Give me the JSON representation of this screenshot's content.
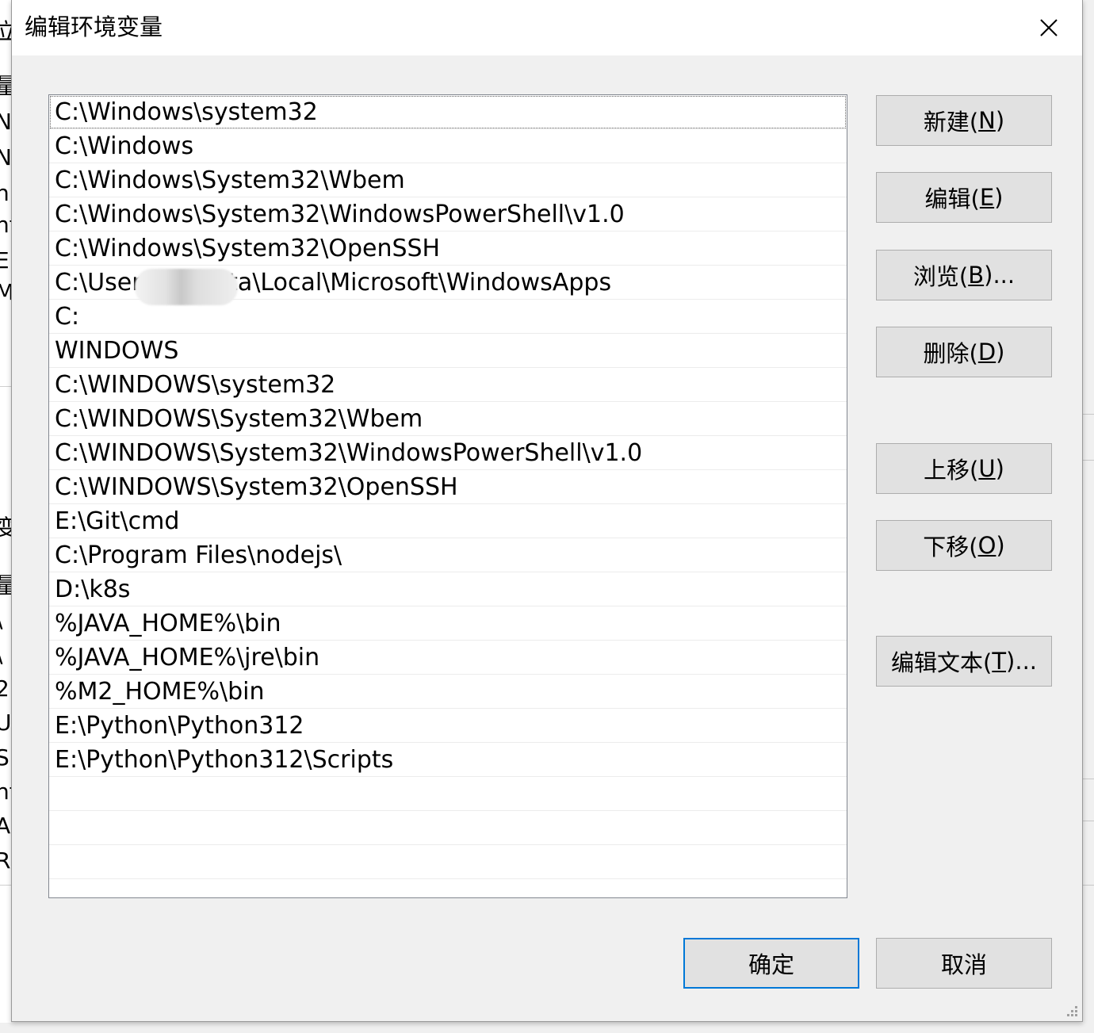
{
  "window": {
    "title": "编辑环境变量"
  },
  "paths": [
    "C:\\Windows\\system32",
    "C:\\Windows",
    "C:\\Windows\\System32\\Wbem",
    "C:\\Windows\\System32\\WindowsPowerShell\\v1.0",
    "C:\\Windows\\System32\\OpenSSH",
    "C:\\User                AppData\\Local\\Microsoft\\WindowsApps",
    "C:",
    "WINDOWS",
    "C:\\WINDOWS\\system32",
    "C:\\WINDOWS\\System32\\Wbem",
    "C:\\WINDOWS\\System32\\WindowsPowerShell\\v1.0",
    "C:\\WINDOWS\\System32\\OpenSSH",
    "E:\\Git\\cmd",
    "C:\\Program Files\\nodejs\\",
    "D:\\k8s",
    "%JAVA_HOME%\\bin",
    "%JAVA_HOME%\\jre\\bin",
    "%M2_HOME%\\bin",
    "E:\\Python\\Python312",
    "E:\\Python\\Python312\\Scripts",
    "",
    "",
    ""
  ],
  "buttons": {
    "new": {
      "pre": "新建(",
      "key": "N",
      "post": ")"
    },
    "edit": {
      "pre": "编辑(",
      "key": "E",
      "post": ")"
    },
    "browse": {
      "pre": "浏览(",
      "key": "B",
      "post": ")..."
    },
    "delete": {
      "pre": "删除(",
      "key": "D",
      "post": ")"
    },
    "move_up": {
      "pre": "上移(",
      "key": "U",
      "post": ")"
    },
    "move_down": {
      "pre": "下移(",
      "key": "O",
      "post": ")"
    },
    "edit_text": {
      "pre": "编辑文本(",
      "key": "T",
      "post": ")..."
    },
    "ok": "确定",
    "cancel": "取消"
  },
  "background_glyphs": [
    "立",
    "量",
    "N",
    "N",
    "n",
    "nt",
    "EN",
    "M",
    "变",
    "量",
    "\\",
    "\\",
    "2",
    "U",
    "S",
    "nt",
    "A",
    "R"
  ],
  "colors": {
    "dialog_bg": "#f0f0f0",
    "button_bg": "#e1e1e1",
    "default_button_border": "#0078d7"
  }
}
